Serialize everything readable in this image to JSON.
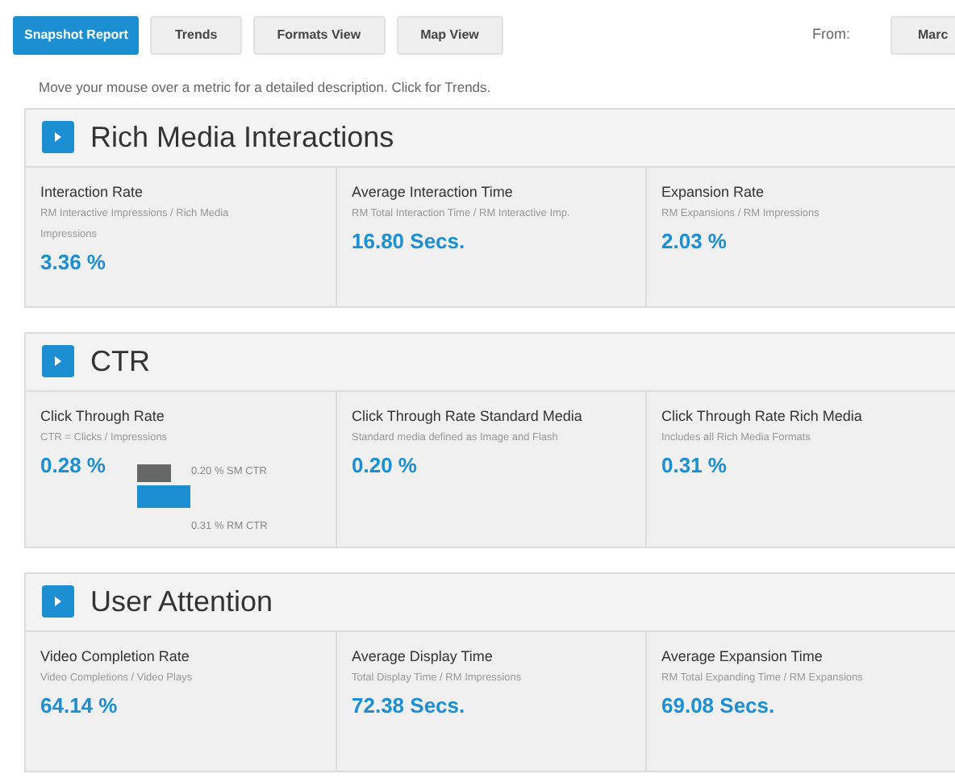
{
  "toolbar": {
    "tabs": [
      {
        "label": "Snapshot Report",
        "selected": true
      },
      {
        "label": "Trends",
        "selected": false
      },
      {
        "label": "Formats View",
        "selected": false
      },
      {
        "label": "Map View",
        "selected": false
      }
    ],
    "from_label": "From:",
    "from_value": "Marc"
  },
  "hint": "Move your mouse over a metric for a detailed description. Click for Trends.",
  "sections": [
    {
      "title": "Rich Media Interactions",
      "metrics": [
        {
          "name": "Interaction Rate",
          "formula": "RM Interactive Impressions / Rich Media Impressions",
          "value": "3.36 %"
        },
        {
          "name": "Average Interaction Time",
          "formula": "RM Total Interaction Time / RM Interactive Imp.",
          "value": "16.80 Secs."
        },
        {
          "name": "Expansion Rate",
          "formula": "RM Expansions / RM Impressions",
          "value": "2.03 %"
        }
      ]
    },
    {
      "title": "CTR",
      "metrics": [
        {
          "name": "Click Through Rate",
          "formula": "CTR = Clicks / Impressions",
          "value": "0.28 %",
          "comparison_labels": [
            "0.20 % SM CTR",
            "0.31 % RM CTR"
          ]
        },
        {
          "name": "Click Through Rate Standard Media",
          "formula": "Standard media defined as Image and Flash",
          "value": "0.20 %"
        },
        {
          "name": "Click Through Rate Rich Media",
          "formula": "Includes all Rich Media Formats",
          "value": "0.31 %"
        }
      ]
    },
    {
      "title": "User Attention",
      "metrics": [
        {
          "name": "Video Completion Rate",
          "formula": "Video Completions / Video Plays",
          "value": "64.14 %"
        },
        {
          "name": "Average Display Time",
          "formula": "Total Display Time / RM Impressions",
          "value": "72.38 Secs."
        },
        {
          "name": "Average Expansion Time",
          "formula": "RM Total Expanding Time / RM Expansions",
          "value": "69.08 Secs."
        }
      ]
    }
  ]
}
